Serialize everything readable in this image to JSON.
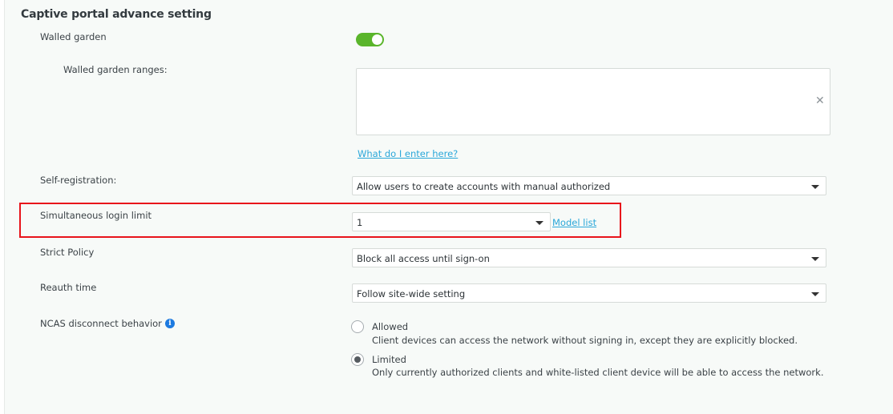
{
  "section": {
    "title": "Captive portal advance setting"
  },
  "walled_garden": {
    "label": "Walled garden",
    "enabled": true
  },
  "walled_garden_ranges": {
    "label": "Walled garden ranges:",
    "value": "",
    "help_link": "What do I enter here?"
  },
  "self_registration": {
    "label": "Self-registration:",
    "selected": "Allow users to create accounts with manual authorized"
  },
  "simultaneous_login": {
    "label": "Simultaneous login limit",
    "selected": "1",
    "model_link": "Model list"
  },
  "strict_policy": {
    "label": "Strict Policy",
    "selected": "Block all access until sign-on"
  },
  "reauth_time": {
    "label": "Reauth time",
    "selected": "Follow site-wide setting"
  },
  "ncas": {
    "label": "NCAS disconnect behavior",
    "info_icon": "info-icon",
    "options": [
      {
        "title": "Allowed",
        "description": "Client devices can access the network without signing in, except they are explicitly blocked.",
        "checked": false
      },
      {
        "title": "Limited",
        "description": "Only currently authorized clients and white-listed client device will be able to access the network.",
        "checked": true
      }
    ]
  },
  "colors": {
    "accent_green": "#5ab52b",
    "link_blue": "#2aa7d9",
    "highlight_red": "#e8141b",
    "info_blue": "#1d7ae0"
  }
}
